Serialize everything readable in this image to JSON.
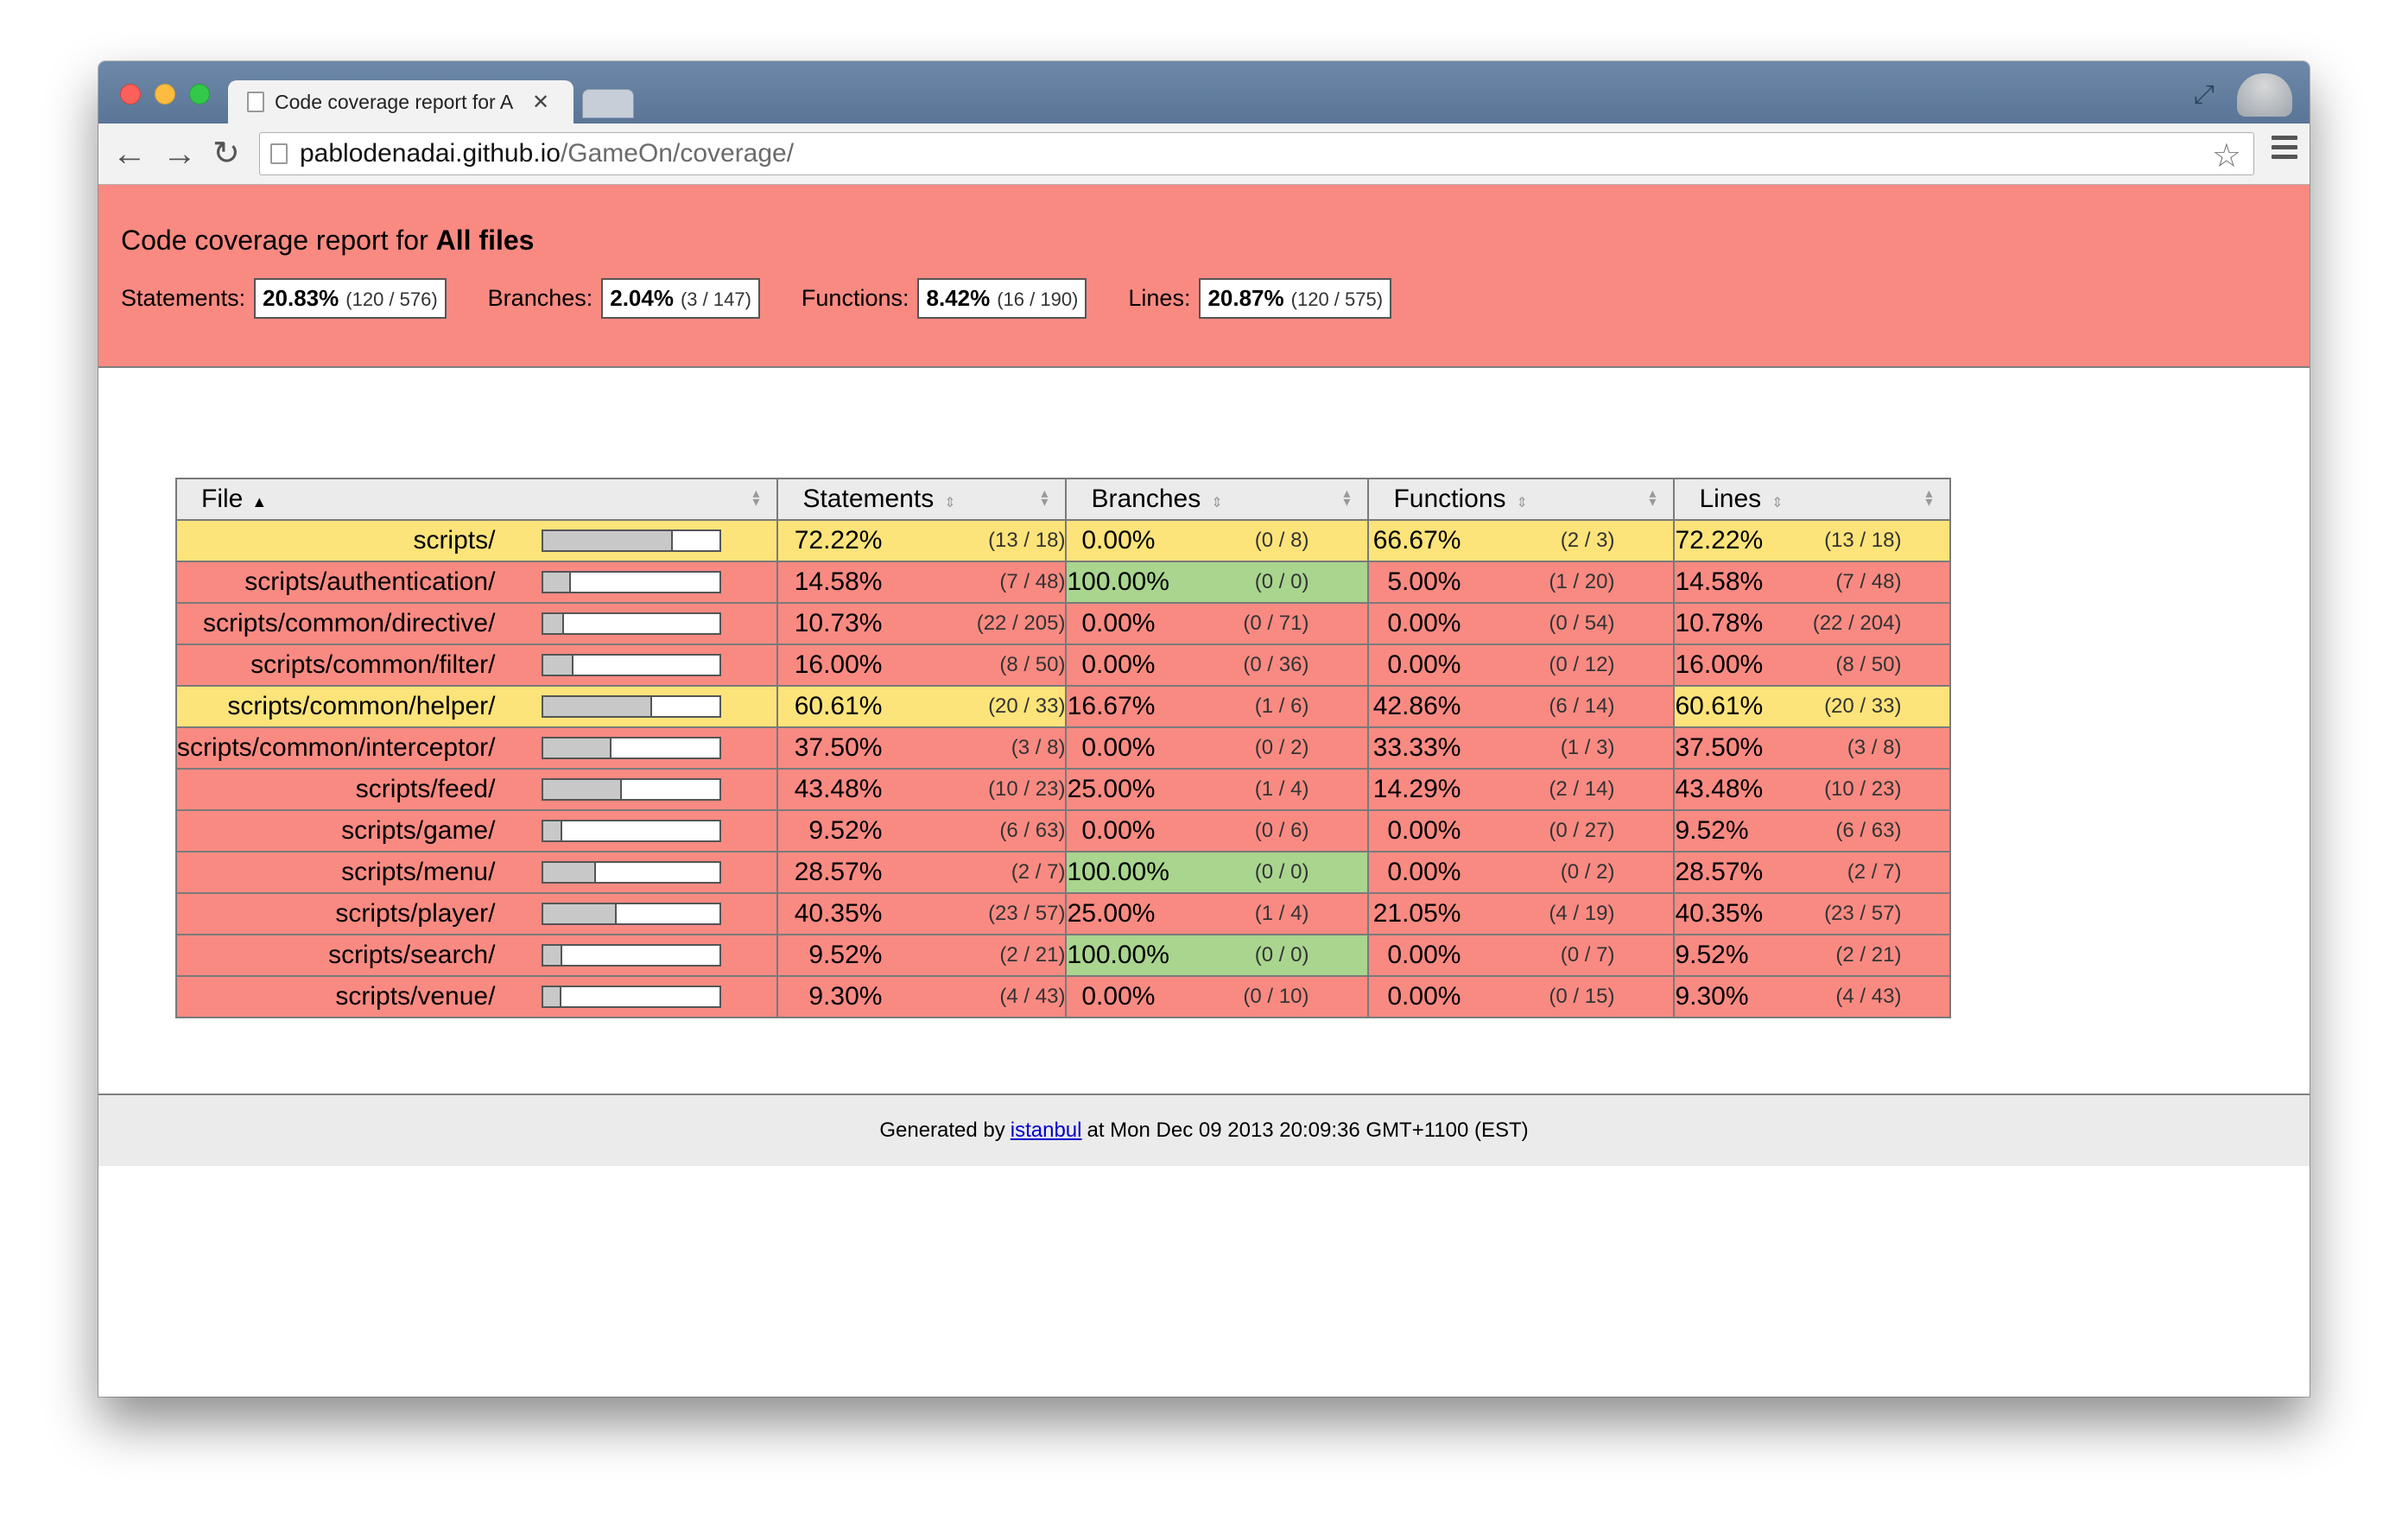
{
  "browser": {
    "tab_title": "Code coverage report for A",
    "url_host": "pablodenadai.github.io",
    "url_path": "/GameOn/coverage/"
  },
  "report": {
    "title_prefix": "Code coverage report for ",
    "title_bold": "All files",
    "summary": [
      {
        "label": "Statements:",
        "pct": "20.83%",
        "frac": "(120 / 576)"
      },
      {
        "label": "Branches:",
        "pct": "2.04%",
        "frac": "(3 / 147)"
      },
      {
        "label": "Functions:",
        "pct": "8.42%",
        "frac": "(16 / 190)"
      },
      {
        "label": "Lines:",
        "pct": "20.87%",
        "frac": "(120 / 575)"
      }
    ]
  },
  "table": {
    "headers": [
      "File",
      "Statements",
      "Branches",
      "Functions",
      "Lines"
    ],
    "rows": [
      {
        "file": "scripts/",
        "level": "medium",
        "bar": 0.7222,
        "stmt": "72.22%",
        "stmt_f": "(13 / 18)",
        "br": "0.00%",
        "br_f": "(0 / 8)",
        "br_level": "low",
        "fn": "66.67%",
        "fn_f": "(2 / 3)",
        "ln": "72.22%",
        "ln_f": "(13 / 18)"
      },
      {
        "file": "scripts/authentication/",
        "level": "low",
        "bar": 0.1458,
        "stmt": "14.58%",
        "stmt_f": "(7 / 48)",
        "br": "100.00%",
        "br_f": "(0 / 0)",
        "br_level": "high",
        "fn": "5.00%",
        "fn_f": "(1 / 20)",
        "ln": "14.58%",
        "ln_f": "(7 / 48)"
      },
      {
        "file": "scripts/common/directive/",
        "level": "low",
        "bar": 0.1073,
        "stmt": "10.73%",
        "stmt_f": "(22 / 205)",
        "br": "0.00%",
        "br_f": "(0 / 71)",
        "br_level": "low",
        "fn": "0.00%",
        "fn_f": "(0 / 54)",
        "ln": "10.78%",
        "ln_f": "(22 / 204)"
      },
      {
        "file": "scripts/common/filter/",
        "level": "low",
        "bar": 0.16,
        "stmt": "16.00%",
        "stmt_f": "(8 / 50)",
        "br": "0.00%",
        "br_f": "(0 / 36)",
        "br_level": "low",
        "fn": "0.00%",
        "fn_f": "(0 / 12)",
        "ln": "16.00%",
        "ln_f": "(8 / 50)"
      },
      {
        "file": "scripts/common/helper/",
        "level": "medium",
        "bar": 0.6061,
        "stmt": "60.61%",
        "stmt_f": "(20 / 33)",
        "br": "16.67%",
        "br_f": "(1 / 6)",
        "br_level": "low",
        "fn": "42.86%",
        "fn_f": "(6 / 14)",
        "ln": "60.61%",
        "ln_f": "(20 / 33)",
        "mixed": true
      },
      {
        "file": "scripts/common/interceptor/",
        "level": "low",
        "bar": 0.375,
        "stmt": "37.50%",
        "stmt_f": "(3 / 8)",
        "br": "0.00%",
        "br_f": "(0 / 2)",
        "br_level": "low",
        "fn": "33.33%",
        "fn_f": "(1 / 3)",
        "ln": "37.50%",
        "ln_f": "(3 / 8)"
      },
      {
        "file": "scripts/feed/",
        "level": "low",
        "bar": 0.4348,
        "stmt": "43.48%",
        "stmt_f": "(10 / 23)",
        "br": "25.00%",
        "br_f": "(1 / 4)",
        "br_level": "low",
        "fn": "14.29%",
        "fn_f": "(2 / 14)",
        "ln": "43.48%",
        "ln_f": "(10 / 23)"
      },
      {
        "file": "scripts/game/",
        "level": "low",
        "bar": 0.0952,
        "stmt": "9.52%",
        "stmt_f": "(6 / 63)",
        "br": "0.00%",
        "br_f": "(0 / 6)",
        "br_level": "low",
        "fn": "0.00%",
        "fn_f": "(0 / 27)",
        "ln": "9.52%",
        "ln_f": "(6 / 63)"
      },
      {
        "file": "scripts/menu/",
        "level": "low",
        "bar": 0.2857,
        "stmt": "28.57%",
        "stmt_f": "(2 / 7)",
        "br": "100.00%",
        "br_f": "(0 / 0)",
        "br_level": "high",
        "fn": "0.00%",
        "fn_f": "(0 / 2)",
        "ln": "28.57%",
        "ln_f": "(2 / 7)"
      },
      {
        "file": "scripts/player/",
        "level": "low",
        "bar": 0.4035,
        "stmt": "40.35%",
        "stmt_f": "(23 / 57)",
        "br": "25.00%",
        "br_f": "(1 / 4)",
        "br_level": "low",
        "fn": "21.05%",
        "fn_f": "(4 / 19)",
        "ln": "40.35%",
        "ln_f": "(23 / 57)"
      },
      {
        "file": "scripts/search/",
        "level": "low",
        "bar": 0.0952,
        "stmt": "9.52%",
        "stmt_f": "(2 / 21)",
        "br": "100.00%",
        "br_f": "(0 / 0)",
        "br_level": "high",
        "fn": "0.00%",
        "fn_f": "(0 / 7)",
        "ln": "9.52%",
        "ln_f": "(2 / 21)"
      },
      {
        "file": "scripts/venue/",
        "level": "low",
        "bar": 0.093,
        "stmt": "9.30%",
        "stmt_f": "(4 / 43)",
        "br": "0.00%",
        "br_f": "(0 / 10)",
        "br_level": "low",
        "fn": "0.00%",
        "fn_f": "(0 / 15)",
        "ln": "9.30%",
        "ln_f": "(4 / 43)"
      }
    ]
  },
  "footer": {
    "prefix": "Generated by",
    "link": "istanbul",
    "suffix": "at Mon Dec 09 2013 20:09:36 GMT+1100 (EST)"
  },
  "colors": {
    "low": "#f88a82",
    "medium": "#fce47a",
    "high": "#a9d58f"
  }
}
